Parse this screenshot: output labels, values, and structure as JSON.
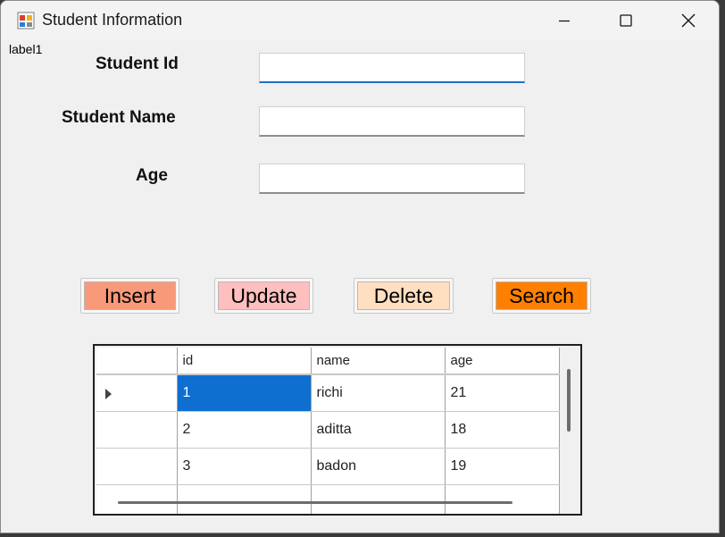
{
  "window": {
    "title": "Student Information",
    "label1": "label1"
  },
  "form": {
    "student_id_label": "Student Id",
    "student_id_value": "",
    "student_name_label": "Student Name",
    "student_name_value": "",
    "age_label": "Age",
    "age_value": ""
  },
  "buttons": {
    "insert": {
      "label": "Insert",
      "color": "#f8997a"
    },
    "update": {
      "label": "Update",
      "color": "#ffbfbf"
    },
    "delete": {
      "label": "Delete",
      "color": "#ffdfc0"
    },
    "search": {
      "label": "Search",
      "color": "#ff8000"
    }
  },
  "grid": {
    "columns": [
      "id",
      "name",
      "age"
    ],
    "rows": [
      {
        "id": "1",
        "name": "richi",
        "age": "21",
        "selected": true
      },
      {
        "id": "2",
        "name": "aditta",
        "age": "18"
      },
      {
        "id": "3",
        "name": "badon",
        "age": "19"
      }
    ]
  },
  "colors": {
    "selection": "#0f6fd1",
    "focus_underline": "#1f6fc7"
  },
  "icons": {
    "app": "winforms-app-icon",
    "minimize": "minimize-icon",
    "maximize": "maximize-icon",
    "close": "close-icon",
    "row_pointer": "row-pointer-icon"
  }
}
